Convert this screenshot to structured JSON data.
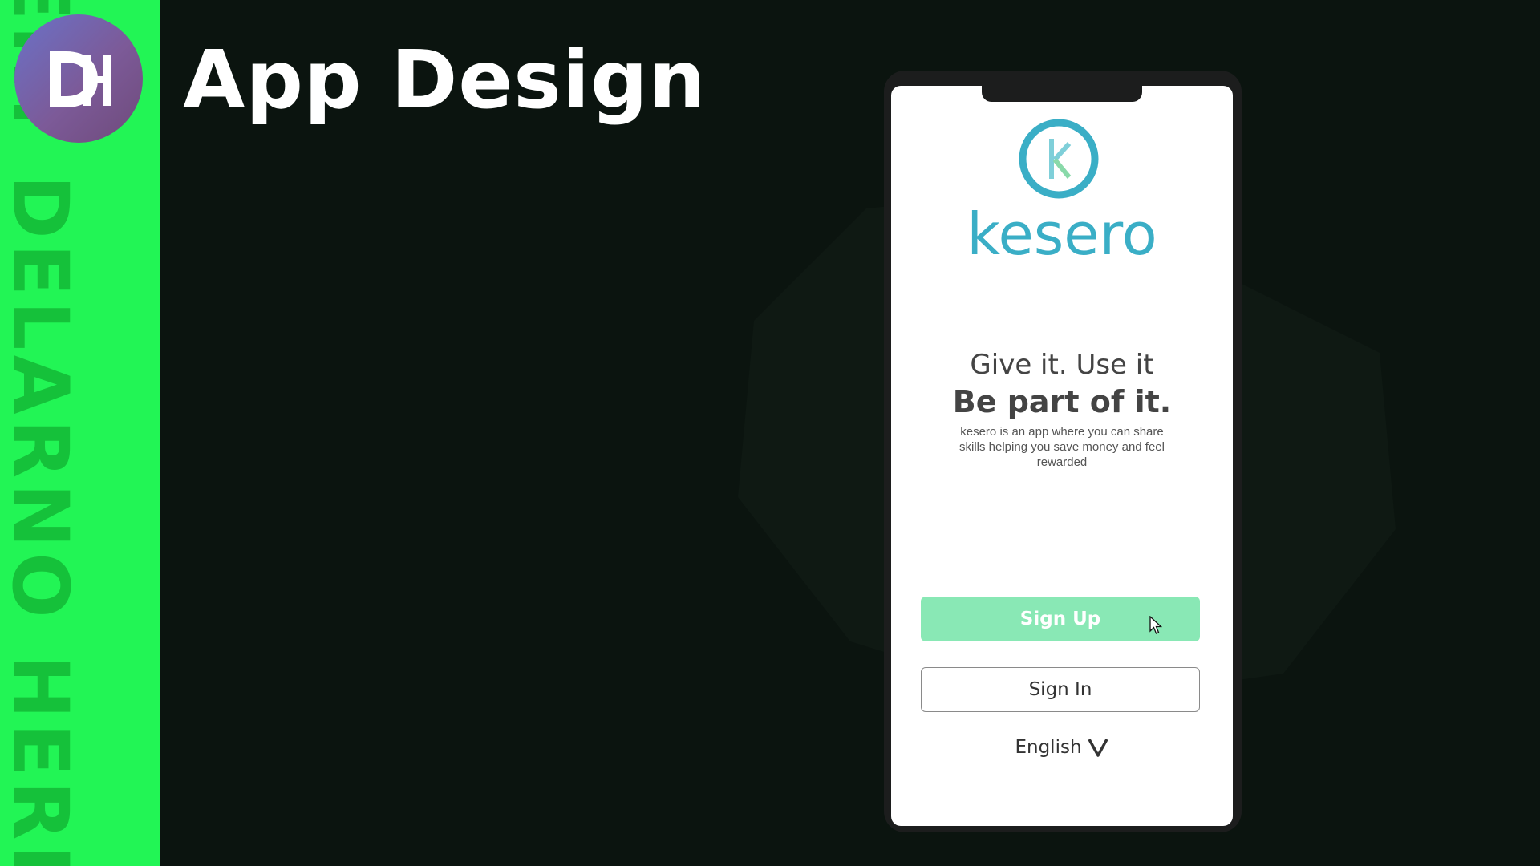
{
  "watermark_text": "ERT DELARNO HERB",
  "brand_logo": {
    "text": "DH",
    "icon": "dh-logo-icon"
  },
  "page_title": "App Design",
  "colors": {
    "background": "#0b140f",
    "sidebar": "#22f555",
    "accent_teal": "#3aaec6",
    "signup_button": "#89e8b5"
  },
  "phone": {
    "app_logo_icon": "kesero-k-logo-icon",
    "app_name": "kesero",
    "headline_line1": "Give it. Use it",
    "headline_line2": "Be part of it.",
    "description": "kesero is an app where you can share skills helping you save money and feel rewarded",
    "signup_label": "Sign Up",
    "signin_label": "Sign In",
    "language": "English",
    "language_icon": "chevron-down-icon"
  }
}
